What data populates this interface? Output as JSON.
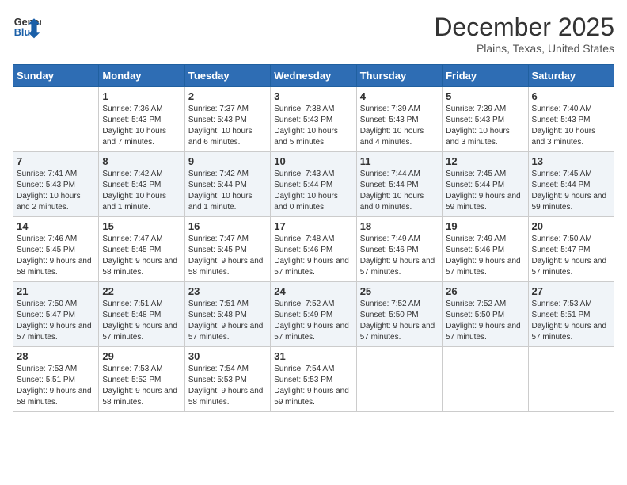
{
  "header": {
    "logo_line1": "General",
    "logo_line2": "Blue",
    "month": "December 2025",
    "location": "Plains, Texas, United States"
  },
  "days_of_week": [
    "Sunday",
    "Monday",
    "Tuesday",
    "Wednesday",
    "Thursday",
    "Friday",
    "Saturday"
  ],
  "weeks": [
    [
      {
        "day": "",
        "sunrise": "",
        "sunset": "",
        "daylight": ""
      },
      {
        "day": "1",
        "sunrise": "Sunrise: 7:36 AM",
        "sunset": "Sunset: 5:43 PM",
        "daylight": "Daylight: 10 hours and 7 minutes."
      },
      {
        "day": "2",
        "sunrise": "Sunrise: 7:37 AM",
        "sunset": "Sunset: 5:43 PM",
        "daylight": "Daylight: 10 hours and 6 minutes."
      },
      {
        "day": "3",
        "sunrise": "Sunrise: 7:38 AM",
        "sunset": "Sunset: 5:43 PM",
        "daylight": "Daylight: 10 hours and 5 minutes."
      },
      {
        "day": "4",
        "sunrise": "Sunrise: 7:39 AM",
        "sunset": "Sunset: 5:43 PM",
        "daylight": "Daylight: 10 hours and 4 minutes."
      },
      {
        "day": "5",
        "sunrise": "Sunrise: 7:39 AM",
        "sunset": "Sunset: 5:43 PM",
        "daylight": "Daylight: 10 hours and 3 minutes."
      },
      {
        "day": "6",
        "sunrise": "Sunrise: 7:40 AM",
        "sunset": "Sunset: 5:43 PM",
        "daylight": "Daylight: 10 hours and 3 minutes."
      }
    ],
    [
      {
        "day": "7",
        "sunrise": "Sunrise: 7:41 AM",
        "sunset": "Sunset: 5:43 PM",
        "daylight": "Daylight: 10 hours and 2 minutes."
      },
      {
        "day": "8",
        "sunrise": "Sunrise: 7:42 AM",
        "sunset": "Sunset: 5:43 PM",
        "daylight": "Daylight: 10 hours and 1 minute."
      },
      {
        "day": "9",
        "sunrise": "Sunrise: 7:42 AM",
        "sunset": "Sunset: 5:44 PM",
        "daylight": "Daylight: 10 hours and 1 minute."
      },
      {
        "day": "10",
        "sunrise": "Sunrise: 7:43 AM",
        "sunset": "Sunset: 5:44 PM",
        "daylight": "Daylight: 10 hours and 0 minutes."
      },
      {
        "day": "11",
        "sunrise": "Sunrise: 7:44 AM",
        "sunset": "Sunset: 5:44 PM",
        "daylight": "Daylight: 10 hours and 0 minutes."
      },
      {
        "day": "12",
        "sunrise": "Sunrise: 7:45 AM",
        "sunset": "Sunset: 5:44 PM",
        "daylight": "Daylight: 9 hours and 59 minutes."
      },
      {
        "day": "13",
        "sunrise": "Sunrise: 7:45 AM",
        "sunset": "Sunset: 5:44 PM",
        "daylight": "Daylight: 9 hours and 59 minutes."
      }
    ],
    [
      {
        "day": "14",
        "sunrise": "Sunrise: 7:46 AM",
        "sunset": "Sunset: 5:45 PM",
        "daylight": "Daylight: 9 hours and 58 minutes."
      },
      {
        "day": "15",
        "sunrise": "Sunrise: 7:47 AM",
        "sunset": "Sunset: 5:45 PM",
        "daylight": "Daylight: 9 hours and 58 minutes."
      },
      {
        "day": "16",
        "sunrise": "Sunrise: 7:47 AM",
        "sunset": "Sunset: 5:45 PM",
        "daylight": "Daylight: 9 hours and 58 minutes."
      },
      {
        "day": "17",
        "sunrise": "Sunrise: 7:48 AM",
        "sunset": "Sunset: 5:46 PM",
        "daylight": "Daylight: 9 hours and 57 minutes."
      },
      {
        "day": "18",
        "sunrise": "Sunrise: 7:49 AM",
        "sunset": "Sunset: 5:46 PM",
        "daylight": "Daylight: 9 hours and 57 minutes."
      },
      {
        "day": "19",
        "sunrise": "Sunrise: 7:49 AM",
        "sunset": "Sunset: 5:46 PM",
        "daylight": "Daylight: 9 hours and 57 minutes."
      },
      {
        "day": "20",
        "sunrise": "Sunrise: 7:50 AM",
        "sunset": "Sunset: 5:47 PM",
        "daylight": "Daylight: 9 hours and 57 minutes."
      }
    ],
    [
      {
        "day": "21",
        "sunrise": "Sunrise: 7:50 AM",
        "sunset": "Sunset: 5:47 PM",
        "daylight": "Daylight: 9 hours and 57 minutes."
      },
      {
        "day": "22",
        "sunrise": "Sunrise: 7:51 AM",
        "sunset": "Sunset: 5:48 PM",
        "daylight": "Daylight: 9 hours and 57 minutes."
      },
      {
        "day": "23",
        "sunrise": "Sunrise: 7:51 AM",
        "sunset": "Sunset: 5:48 PM",
        "daylight": "Daylight: 9 hours and 57 minutes."
      },
      {
        "day": "24",
        "sunrise": "Sunrise: 7:52 AM",
        "sunset": "Sunset: 5:49 PM",
        "daylight": "Daylight: 9 hours and 57 minutes."
      },
      {
        "day": "25",
        "sunrise": "Sunrise: 7:52 AM",
        "sunset": "Sunset: 5:50 PM",
        "daylight": "Daylight: 9 hours and 57 minutes."
      },
      {
        "day": "26",
        "sunrise": "Sunrise: 7:52 AM",
        "sunset": "Sunset: 5:50 PM",
        "daylight": "Daylight: 9 hours and 57 minutes."
      },
      {
        "day": "27",
        "sunrise": "Sunrise: 7:53 AM",
        "sunset": "Sunset: 5:51 PM",
        "daylight": "Daylight: 9 hours and 57 minutes."
      }
    ],
    [
      {
        "day": "28",
        "sunrise": "Sunrise: 7:53 AM",
        "sunset": "Sunset: 5:51 PM",
        "daylight": "Daylight: 9 hours and 58 minutes."
      },
      {
        "day": "29",
        "sunrise": "Sunrise: 7:53 AM",
        "sunset": "Sunset: 5:52 PM",
        "daylight": "Daylight: 9 hours and 58 minutes."
      },
      {
        "day": "30",
        "sunrise": "Sunrise: 7:54 AM",
        "sunset": "Sunset: 5:53 PM",
        "daylight": "Daylight: 9 hours and 58 minutes."
      },
      {
        "day": "31",
        "sunrise": "Sunrise: 7:54 AM",
        "sunset": "Sunset: 5:53 PM",
        "daylight": "Daylight: 9 hours and 59 minutes."
      },
      {
        "day": "",
        "sunrise": "",
        "sunset": "",
        "daylight": ""
      },
      {
        "day": "",
        "sunrise": "",
        "sunset": "",
        "daylight": ""
      },
      {
        "day": "",
        "sunrise": "",
        "sunset": "",
        "daylight": ""
      }
    ]
  ]
}
